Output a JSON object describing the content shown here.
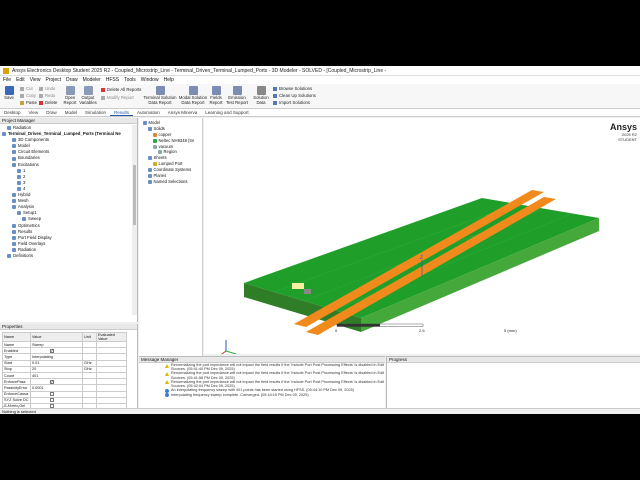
{
  "window": {
    "title": "Ansys Electronics Desktop Student 2025 R2 - Coupled_Microstrip_Line - Terminal_Driven_Terminal_Lumped_Ports - 3D Modeler - SOLVED - [Coupled_Microstrip_Line -"
  },
  "menu": [
    "File",
    "Edit",
    "View",
    "Project",
    "Draw",
    "Modeler",
    "HFSS",
    "Tools",
    "Window",
    "Help"
  ],
  "ribbon": {
    "save": "Save",
    "clip": [
      "Cut",
      "Copy",
      "Paste"
    ],
    "undo": [
      "Undo",
      "Redo",
      "Delete"
    ],
    "open_report": "Open Report",
    "output_vars": "Output Variables",
    "delete_reports": "Delete All Reports",
    "modify_report": "Modify Report",
    "terminal_solution": "Terminal Solution Data Report",
    "modal_solution": "Modal Solution Data Report",
    "fields_report": "Fields Report",
    "emission_test": "Emission Test Report",
    "solution_data": "Solution Data",
    "browse_solutions": "Browse Solutions",
    "clean_up": "Clean Up Solutions",
    "import_solutions": "Import Solutions"
  },
  "tabs": [
    "Desktop",
    "View",
    "Draw",
    "Model",
    "Simulation",
    "Results",
    "Automation",
    "Ansys Minerva",
    "Learning and Support"
  ],
  "active_tab": "Results",
  "project_manager": {
    "title": "Project Manager",
    "items": [
      {
        "label": "Radiation",
        "indent": 1
      },
      {
        "label": "Terminal_Driven_Terminal_Lumped_Ports (Terminal Ne",
        "indent": 0
      },
      {
        "label": "3D Components",
        "indent": 2
      },
      {
        "label": "Model",
        "indent": 2
      },
      {
        "label": "Circuit Elements",
        "indent": 2
      },
      {
        "label": "Boundaries",
        "indent": 2
      },
      {
        "label": "Excitations",
        "indent": 2
      },
      {
        "label": "1",
        "indent": 3
      },
      {
        "label": "2",
        "indent": 3
      },
      {
        "label": "3",
        "indent": 3
      },
      {
        "label": "4",
        "indent": 3
      },
      {
        "label": "Hybrid",
        "indent": 2
      },
      {
        "label": "Mesh",
        "indent": 2
      },
      {
        "label": "Analysis",
        "indent": 2
      },
      {
        "label": "Setup1",
        "indent": 3
      },
      {
        "label": "Sweep",
        "indent": 4
      },
      {
        "label": "Optimetrics",
        "indent": 2
      },
      {
        "label": "Results",
        "indent": 2
      },
      {
        "label": "Port Field Display",
        "indent": 2
      },
      {
        "label": "Field Overlays",
        "indent": 2
      },
      {
        "label": "Radiation",
        "indent": 2
      },
      {
        "label": "Definitions",
        "indent": 1
      }
    ]
  },
  "properties": {
    "title": "Properties",
    "headers": [
      "Name",
      "Value",
      "Unit",
      "Evaluated Value"
    ],
    "rows": [
      {
        "name": "Name",
        "value": "Sweep",
        "unit": "",
        "eval": "",
        "check": ""
      },
      {
        "name": "Enabled",
        "value": "",
        "unit": "",
        "eval": "",
        "check": "on"
      },
      {
        "name": "Type",
        "value": "Interpolating",
        "unit": "",
        "eval": "",
        "check": ""
      },
      {
        "name": "Start",
        "value": "0.01",
        "unit": "GHz",
        "eval": "",
        "check": ""
      },
      {
        "name": "Stop",
        "value": "20",
        "unit": "GHz",
        "eval": "",
        "check": ""
      },
      {
        "name": "Count",
        "value": "401",
        "unit": "",
        "eval": "",
        "check": ""
      },
      {
        "name": "EnforcePass",
        "value": "",
        "unit": "",
        "eval": "",
        "check": "on"
      },
      {
        "name": "PassivityError",
        "value": "0.0001",
        "unit": "",
        "eval": "",
        "check": ""
      },
      {
        "name": "EnforceCausa",
        "value": "",
        "unit": "",
        "eval": "",
        "check": "off"
      },
      {
        "name": "SYZ Solve DC",
        "value": "",
        "unit": "",
        "eval": "",
        "check": "off"
      },
      {
        "name": "S-Matrix Onl",
        "value": "",
        "unit": "",
        "eval": "",
        "check": "off"
      },
      {
        "name": "S-Matrix Onl",
        "value": "Auto",
        "unit": "",
        "eval": "",
        "check": ""
      }
    ],
    "tab": "HFSS"
  },
  "model_tree": [
    {
      "label": "Model",
      "indent": 0,
      "color": "#6a8fc7"
    },
    {
      "label": "Solids",
      "indent": 1,
      "color": "#6a8fc7"
    },
    {
      "label": "copper",
      "indent": 2,
      "color": "#d88a3a"
    },
    {
      "label": "Neltec NH9348 (tm",
      "indent": 2,
      "color": "#2aa84a"
    },
    {
      "label": "vacuum",
      "indent": 2,
      "color": "#8aa"
    },
    {
      "label": "Region",
      "indent": 3,
      "color": "#8aa"
    },
    {
      "label": "Sheets",
      "indent": 1,
      "color": "#6a8fc7"
    },
    {
      "label": "Lumped Port",
      "indent": 2,
      "color": "#c8b020"
    },
    {
      "label": "Coordinate Systems",
      "indent": 1,
      "color": "#6a8fc7"
    },
    {
      "label": "Planes",
      "indent": 1,
      "color": "#6a8fc7"
    },
    {
      "label": "Named Selections",
      "indent": 1,
      "color": "#6a8fc7"
    }
  ],
  "viewport": {
    "brand": "Ansys",
    "version": "2025 R2",
    "edition": "STUDENT",
    "axis_z": "Z",
    "scale_labels": [
      "0",
      "2.5",
      "5 (mm)"
    ]
  },
  "messages": {
    "title": "Message Manager",
    "items": [
      {
        "type": "warn",
        "text": "Renormalizing the port impedance will not impact the field results if the 'Include Port Post Processing Effects' is disabled in Edit Sources. (05:41:40 PM  Dec 09, 2025)"
      },
      {
        "type": "warn",
        "text": "Renormalizing the port impedance will not impact the field results if the 'Include Port Post Processing Effects' is disabled in Edit Sources. (05:41:58 PM  Dec 09, 2025)"
      },
      {
        "type": "warn",
        "text": "Renormalizing the port impedance will not impact the field results if the 'Include Port Post Processing Effects' is disabled in Edit Sources. (05:42:04 PM  Dec 09, 2025)"
      },
      {
        "type": "info",
        "text": "An interpolating frequency sweep with 401 points has been started using HFSS. (05:44:10 PM  Dec 09, 2025)"
      },
      {
        "type": "info",
        "text": "Interpolating frequency sweep complete. Converged. (05:44:15 PM  Dec 09, 2025)"
      }
    ],
    "hide_btn": "Hide 56 Messages"
  },
  "progress": {
    "title": "Progress",
    "hide_btn": "Hide Progress"
  },
  "status": "Nothing is selected"
}
